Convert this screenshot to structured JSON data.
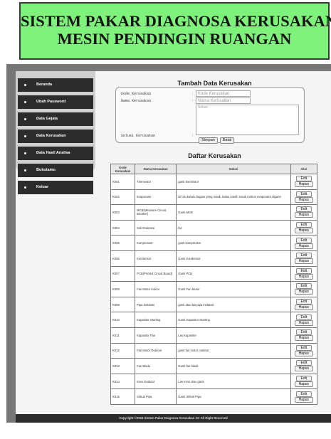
{
  "header": {
    "title_line1": "SISTEM PAKAR DIAGNOSA KERUSAKAN",
    "title_line2": "MESIN PENDINGIN RUANGAN"
  },
  "menu": [
    "Beranda",
    "Ubah Password",
    "Data Gejala",
    "Data Kerusakan",
    "Data Hasil Analisa",
    "Bukutamu",
    "Keluar"
  ],
  "form": {
    "heading": "Tambah Data Kerusakan",
    "kode_label": "Kode Kerusakan",
    "nama_label": "Nama Kerusakan",
    "solusi_label": "Solusi Kerusakan",
    "colon": ":",
    "kode_placeholder": "Kode Kerusakan",
    "nama_placeholder": "Nama Kerusakan",
    "solusi_placeholder": "Solusi",
    "save_label": "Simpan",
    "cancel_label": "Batal"
  },
  "list": {
    "heading": "Daftar Kerusakan",
    "columns": [
      "Kode Kerusakan",
      "Nama Kerusakan",
      "Solusi",
      "Aksi"
    ],
    "edit_label": "Edit",
    "delete_label": "Hapus",
    "rows": [
      [
        "K001",
        "Thermistor",
        "ganti thermistor"
      ],
      [
        "K002",
        "Evaporator",
        "Di las dahulu bagian yang rusak, kalau masih rusak mohon evaporator diganti"
      ],
      [
        "K003",
        "MCB(Miniature Circuit Breaker)",
        "Ganti MCB"
      ],
      [
        "K004",
        "Sok Drainase",
        "las"
      ],
      [
        "K005",
        "Kompressor",
        "ganti kompressor"
      ],
      [
        "K006",
        "Kondensor",
        "Ganti Kondensor"
      ],
      [
        "K007",
        "PCB(Printed Circuit Board)",
        "Ganti PCB"
      ],
      [
        "K008",
        "Fan Motor Indoor",
        "Ganti Fan Motor"
      ],
      [
        "K009",
        "Pipa Instalasi",
        "ganti atau las pipa instalasi"
      ],
      [
        "K010",
        "Kapasitor Starting",
        "Ganti Kapasitor Starting"
      ],
      [
        "K011",
        "Kapasitor Fan",
        "Las Kapasitor"
      ],
      [
        "K012",
        "Fan Motor Outdoor",
        "ganti fan motor outdoor"
      ],
      [
        "K013",
        "Fan Blade",
        "Ganti fan blade"
      ],
      [
        "K014",
        "Kran Outdoor",
        "Las Kran atau ganti"
      ],
      [
        "K015",
        "Sirkuit Pipa",
        "Ganti Sirkuit Pipa"
      ]
    ]
  },
  "footer": {
    "text": "Copyright ©2015 Sistem Pakar Diagnosa Kerusakan AC All Right Reserved"
  }
}
